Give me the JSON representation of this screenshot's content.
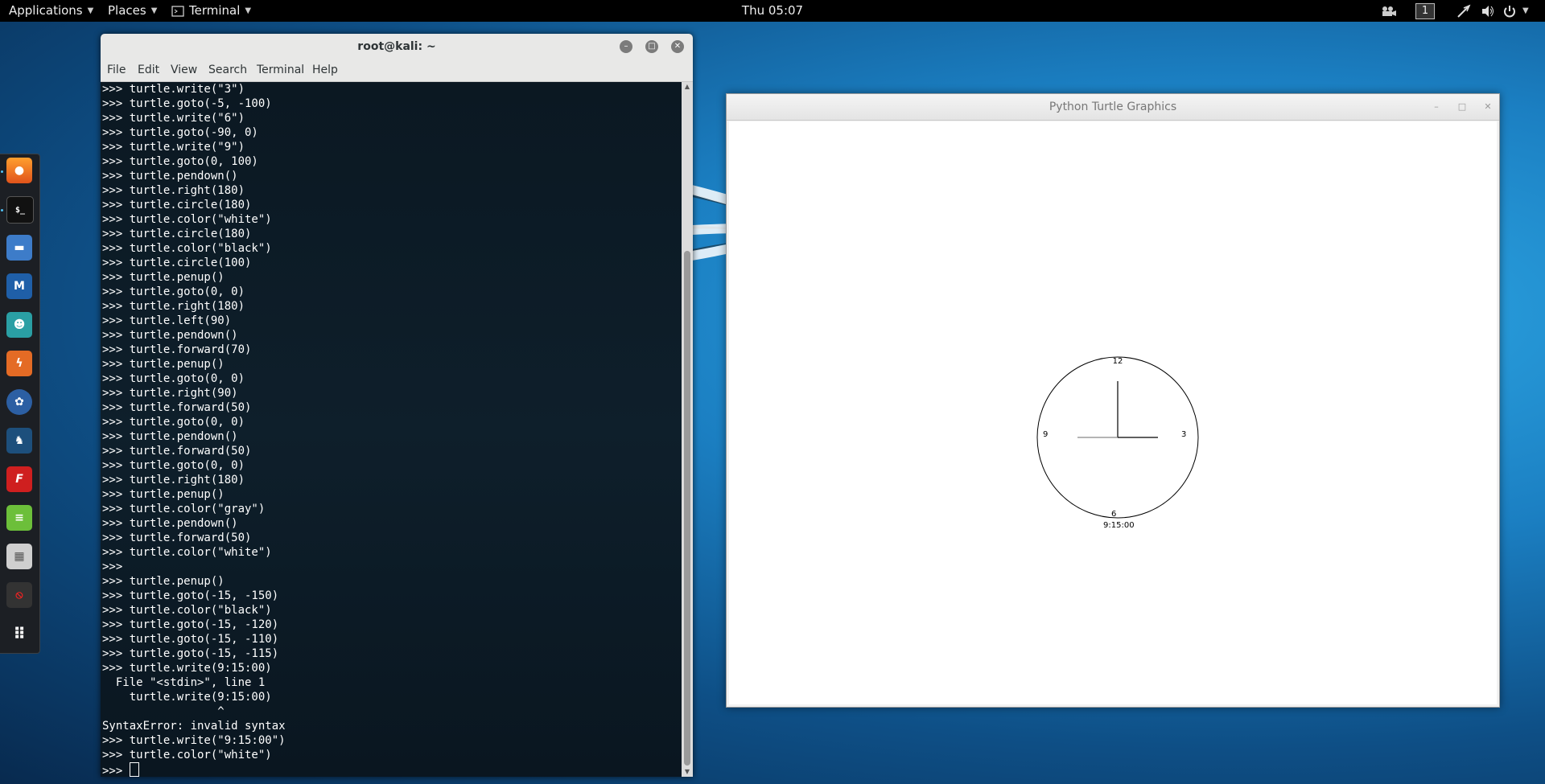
{
  "top_panel": {
    "applications": "Applications",
    "places": "Places",
    "terminal_app": "Terminal",
    "clock": "Thu 05:07",
    "workspace": "1"
  },
  "dock": {
    "items": [
      "firefox-icon",
      "terminal-icon",
      "files-icon",
      "metasploit-icon",
      "armitage-icon",
      "burpsuite-icon",
      "maltego-icon",
      "beef-icon",
      "faraday-icon",
      "leafpad-icon",
      "cherrytree-icon",
      "recordmydesktop-icon",
      "show-apps-icon"
    ]
  },
  "terminal": {
    "title": "root@kali: ~",
    "menu": [
      "File",
      "Edit",
      "View",
      "Search",
      "Terminal",
      "Help"
    ],
    "lines": [
      ">>> turtle.write(\"3\")",
      ">>> turtle.goto(-5, -100)",
      ">>> turtle.write(\"6\")",
      ">>> turtle.goto(-90, 0)",
      ">>> turtle.write(\"9\")",
      ">>> turtle.goto(0, 100)",
      ">>> turtle.pendown()",
      ">>> turtle.right(180)",
      ">>> turtle.circle(180)",
      ">>> turtle.color(\"white\")",
      ">>> turtle.circle(180)",
      ">>> turtle.color(\"black\")",
      ">>> turtle.circle(100)",
      ">>> turtle.penup()",
      ">>> turtle.goto(0, 0)",
      ">>> turtle.right(180)",
      ">>> turtle.left(90)",
      ">>> turtle.pendown()",
      ">>> turtle.forward(70)",
      ">>> turtle.penup()",
      ">>> turtle.goto(0, 0)",
      ">>> turtle.right(90)",
      ">>> turtle.forward(50)",
      ">>> turtle.goto(0, 0)",
      ">>> turtle.pendown()",
      ">>> turtle.forward(50)",
      ">>> turtle.goto(0, 0)",
      ">>> turtle.right(180)",
      ">>> turtle.penup()",
      ">>> turtle.color(\"gray\")",
      ">>> turtle.pendown()",
      ">>> turtle.forward(50)",
      ">>> turtle.color(\"white\")",
      ">>>",
      ">>> turtle.penup()",
      ">>> turtle.goto(-15, -150)",
      ">>> turtle.color(\"black\")",
      ">>> turtle.goto(-15, -120)",
      ">>> turtle.goto(-15, -110)",
      ">>> turtle.goto(-15, -115)",
      ">>> turtle.write(9:15:00)",
      "  File \"<stdin>\", line 1",
      "    turtle.write(9:15:00)",
      "                 ^",
      "SyntaxError: invalid syntax",
      ">>> turtle.write(\"9:15:00\")",
      ">>> turtle.color(\"white\")"
    ],
    "prompt": ">>> "
  },
  "turtle_window": {
    "title": "Python Turtle Graphics",
    "clock_labels": {
      "twelve": "12",
      "three": "3",
      "six": "6",
      "nine": "9"
    },
    "time_text": "9:15:00"
  }
}
